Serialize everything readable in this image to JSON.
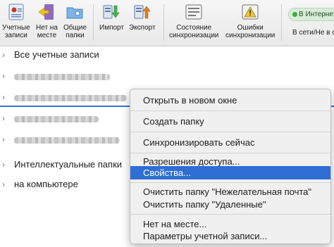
{
  "toolbar": {
    "accounts": "Учетные\nзаписи",
    "away": "Нет на\nместе",
    "shared": "Общие\nпапки",
    "import": "Импорт",
    "export": "Экспорт",
    "sync_status": "Состояние\nсинхронизации",
    "sync_errors": "Ошибки\nсинхронизации",
    "online_badge": "В Интернете",
    "online_status": "В сети/Не в сети"
  },
  "folders": {
    "all_accounts": "Все учетные записи",
    "smart_folders": "Интеллектуальные папки",
    "on_computer": "на компьютере"
  },
  "menu": {
    "open_new_window": "Открыть в новом окне",
    "create_folder": "Создать папку",
    "sync_now": "Синхронизировать сейчас",
    "permissions": "Разрешения доступа...",
    "properties": "Свойства...",
    "empty_junk": "Очистить папку \"Нежелательная почта\"",
    "empty_deleted": "Очистить папку \"Удаленные\"",
    "away": "Нет на месте...",
    "account_settings": "Параметры учетной записи..."
  },
  "colors": {
    "selection": "#2f6fd4",
    "online_dot": "#3dad3d"
  }
}
